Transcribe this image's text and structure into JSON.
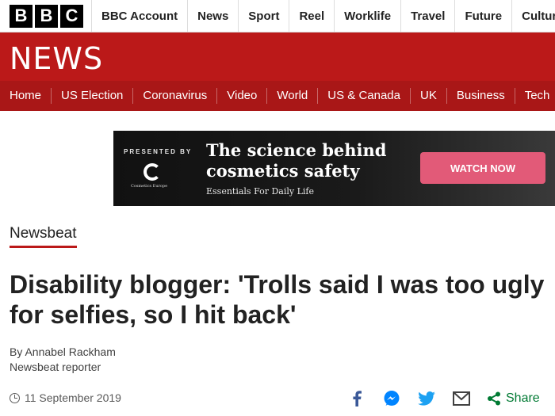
{
  "brand": {
    "logo_letters": [
      "B",
      "B",
      "C"
    ]
  },
  "top_nav": [
    "BBC Account",
    "News",
    "Sport",
    "Reel",
    "Worklife",
    "Travel",
    "Future",
    "Culture"
  ],
  "news_band": {
    "title": "NEWS"
  },
  "section_nav": [
    "Home",
    "US Election",
    "Coronavirus",
    "Video",
    "World",
    "US & Canada",
    "UK",
    "Business",
    "Tech"
  ],
  "ad": {
    "presented_by": "PRESENTED BY",
    "sponsor_small": "Cosmetics Europe",
    "headline_line1": "The science behind",
    "headline_line2": "cosmetics safety",
    "subline": "Essentials For Daily Life",
    "cta": "WATCH NOW"
  },
  "article": {
    "section": "Newsbeat",
    "headline": "Disability blogger: 'Trolls said I was too ugly for selfies, so I hit back'",
    "author": "By Annabel Rackham",
    "author_role": "Newsbeat reporter",
    "date": "11 September 2019"
  },
  "share": {
    "label": "Share",
    "icons": [
      "facebook-icon",
      "messenger-icon",
      "twitter-icon",
      "email-icon",
      "share-icon"
    ]
  },
  "colors": {
    "news_red": "#bb1919",
    "nav_red": "#a91717",
    "share_green": "#007a33",
    "facebook": "#3b5998",
    "messenger": "#0084ff",
    "twitter": "#1da1f2",
    "cta_pink": "#e25a78"
  }
}
